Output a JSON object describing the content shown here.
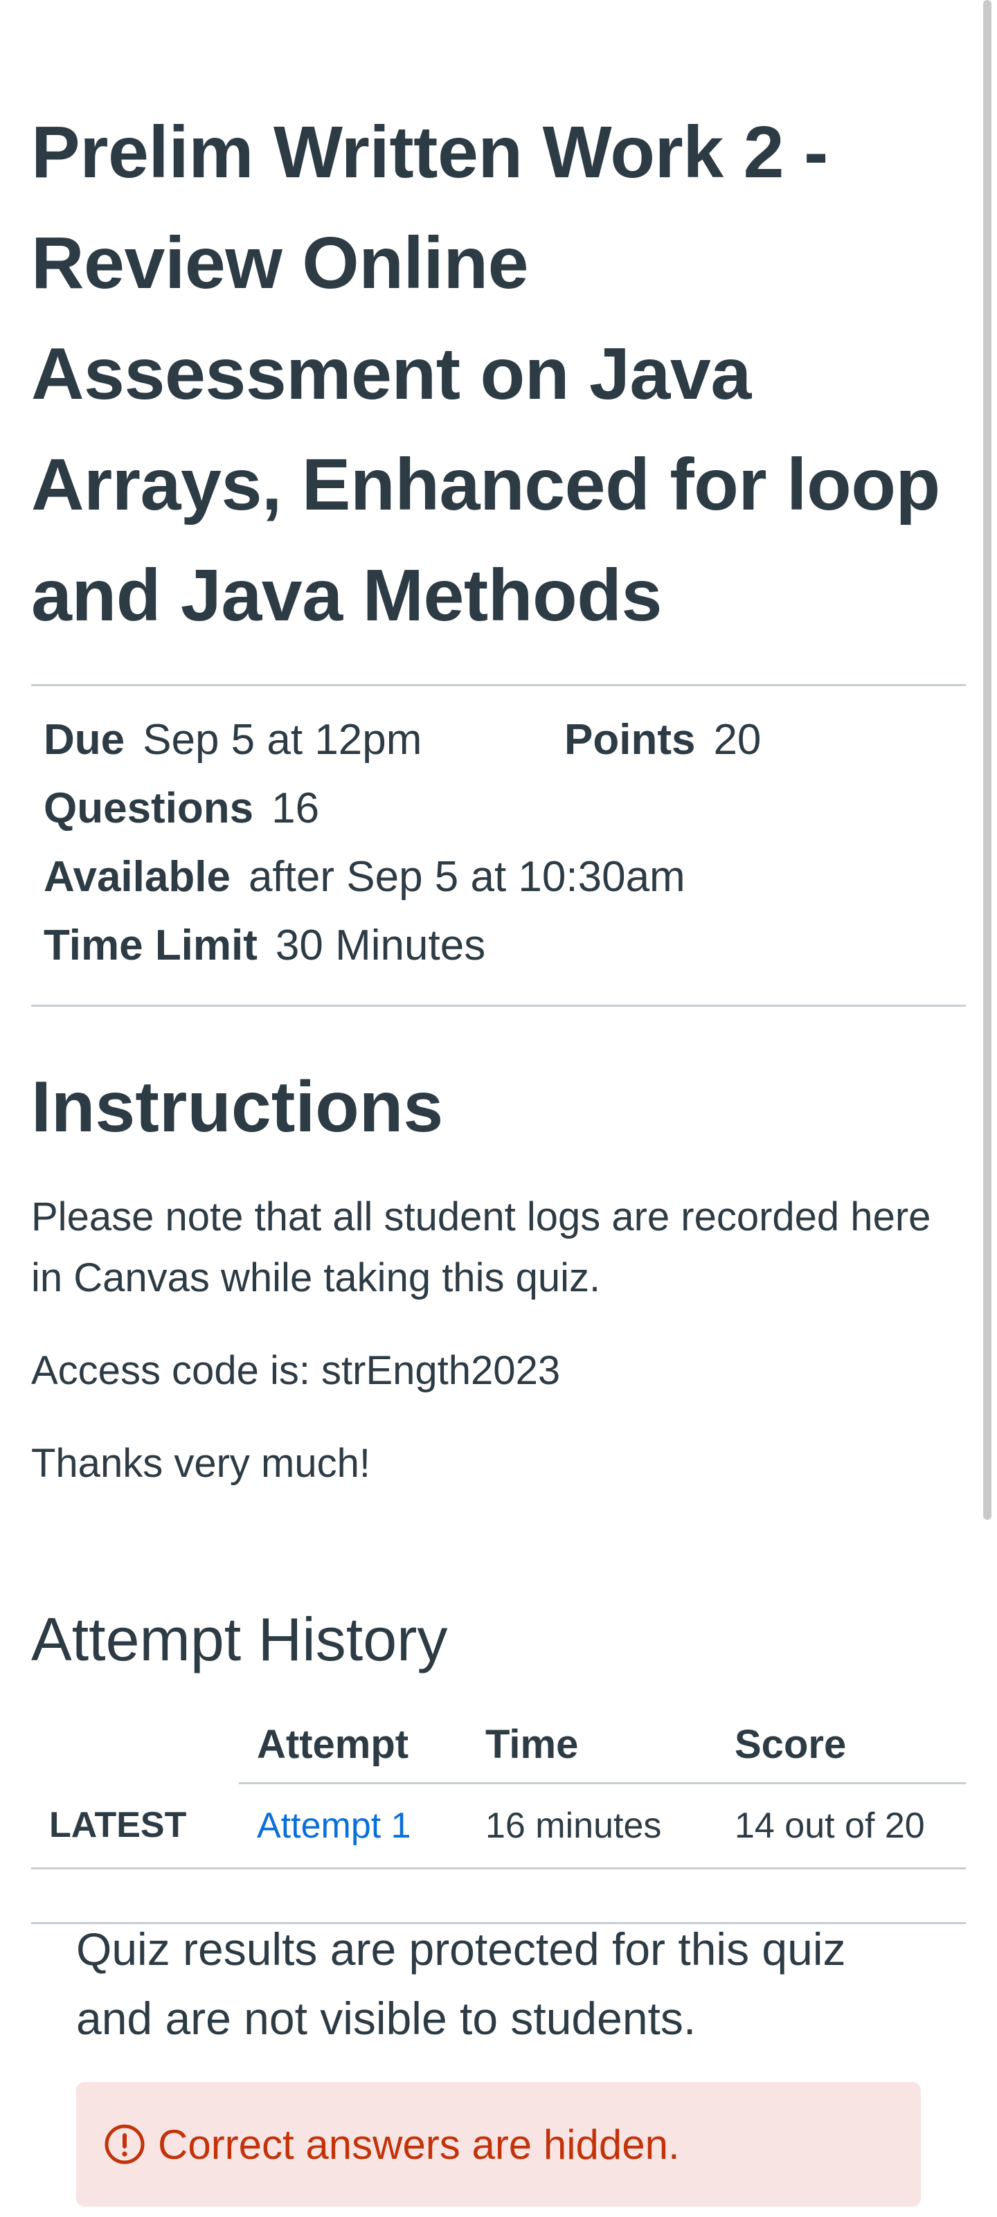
{
  "quiz": {
    "title": "Prelim Written Work 2 - Review Online Assessment on Java Arrays, Enhanced for loop and Java Methods",
    "details": {
      "due_label": "Due",
      "due_value": "Sep 5 at 12pm",
      "points_label": "Points",
      "points_value": "20",
      "questions_label": "Questions",
      "questions_value": "16",
      "available_label": "Available",
      "available_value": "after Sep 5 at 10:30am",
      "time_limit_label": "Time Limit",
      "time_limit_value": "30 Minutes"
    }
  },
  "instructions": {
    "heading": "Instructions",
    "paragraphs": [
      "Please note that all student logs are recorded here in Canvas while taking this quiz.",
      "Access code is: strEngth2023",
      "Thanks very much!"
    ]
  },
  "attempt_history": {
    "heading": "Attempt History",
    "columns": [
      "",
      "Attempt",
      "Time",
      "Score"
    ],
    "rows": [
      {
        "tag": "LATEST",
        "attempt": "Attempt 1",
        "time": "16 minutes",
        "score": "14 out of 20"
      }
    ]
  },
  "results": {
    "message": "Quiz results are protected for this quiz and are not visible to students.",
    "alert": "Correct answers are hidden.",
    "alert_icon": "warning-circle-icon",
    "alert_color": "#c2330a",
    "alert_bg": "#f8e5e3"
  },
  "colors": {
    "text": "#2d3b45",
    "link": "#0b6fd8",
    "divider": "#c7cdd1"
  }
}
